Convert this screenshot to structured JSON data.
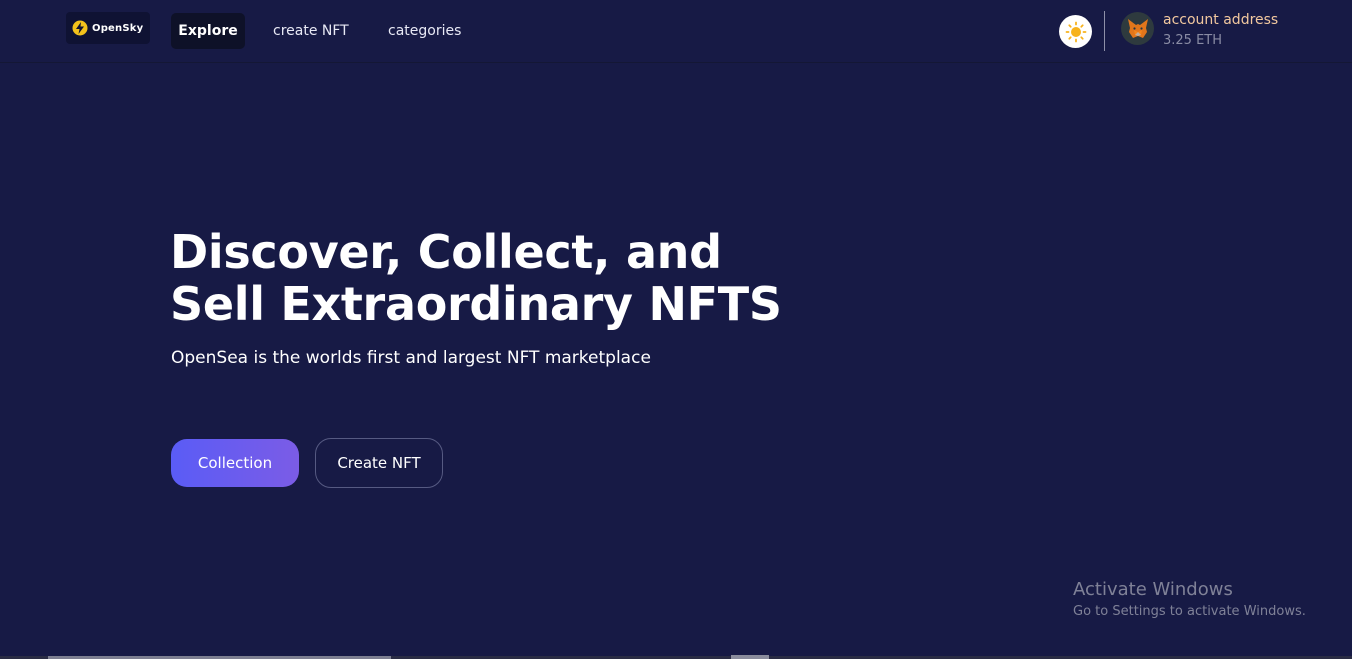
{
  "header": {
    "logo": {
      "text": "OpenSky",
      "icon": "lightning-bolt-icon"
    },
    "nav": {
      "explore": "Explore",
      "create_nft": "create NFT",
      "categories": "categories"
    },
    "theme_toggle_icon": "sun-icon",
    "account": {
      "avatar_icon": "metamask-fox-icon",
      "name": "account address",
      "balance": "3.25 ETH"
    }
  },
  "hero": {
    "title": "Discover, Collect, and Sell Extraordinary NFTS",
    "subtitle": "OpenSea is the worlds first and largest NFT marketplace",
    "primary_button": "Collection",
    "secondary_button": "Create NFT"
  },
  "watermark": {
    "title": "Activate Windows",
    "subtitle": "Go to Settings to activate Windows."
  },
  "colors": {
    "background": "#171a45",
    "accent_gradient_start": "#5a5cf6",
    "accent_gradient_end": "#7b5ce6",
    "account_name": "#f2c89f"
  }
}
